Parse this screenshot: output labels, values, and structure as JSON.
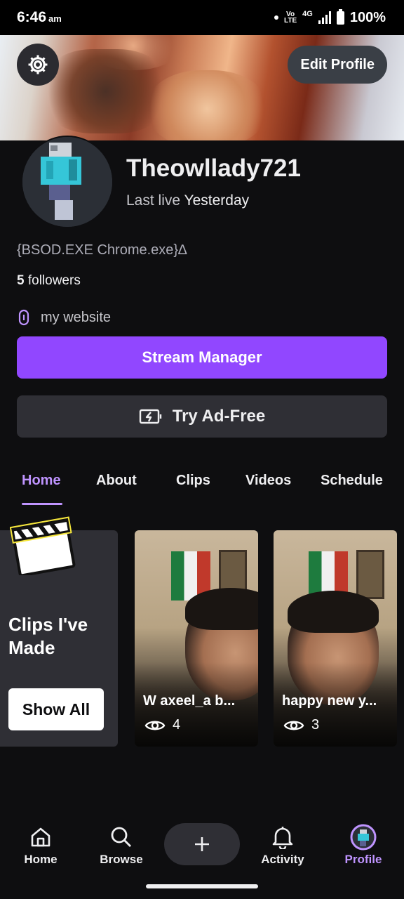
{
  "status_bar": {
    "time": "6:46",
    "ampm": "am",
    "volte_top": "Vo",
    "volte_bottom": "LTE",
    "network": "4G",
    "battery": "100%"
  },
  "header": {
    "edit_profile_label": "Edit Profile"
  },
  "profile": {
    "username": "Theowllady721",
    "last_live_prefix": "Last live",
    "last_live_value": "Yesterday",
    "bio": "{BSOD.EXE Chrome.exe}∆",
    "followers_count": "5",
    "followers_label": "followers",
    "website_label": "my website"
  },
  "actions": {
    "stream_manager": "Stream Manager",
    "ad_free": "Try Ad-Free"
  },
  "tabs": [
    {
      "label": "Home",
      "active": true
    },
    {
      "label": "About"
    },
    {
      "label": "Clips"
    },
    {
      "label": "Videos"
    },
    {
      "label": "Schedule"
    }
  ],
  "clips_card": {
    "title": "Clips I've Made",
    "show_all": "Show All"
  },
  "clips": [
    {
      "title": "W axeel_a b...",
      "views": "4"
    },
    {
      "title": "happy new y...",
      "views": "3"
    }
  ],
  "bottom_nav": [
    {
      "label": "Home",
      "icon": "home-icon"
    },
    {
      "label": "Browse",
      "icon": "search-icon"
    },
    {
      "label": "Activity",
      "icon": "bell-icon"
    },
    {
      "label": "Profile",
      "icon": "avatar-icon",
      "active": true
    }
  ],
  "colors": {
    "accent": "#9147ff",
    "accent_light": "#bf94ff",
    "background": "#0e0e10",
    "surface": "#2f2f35"
  }
}
